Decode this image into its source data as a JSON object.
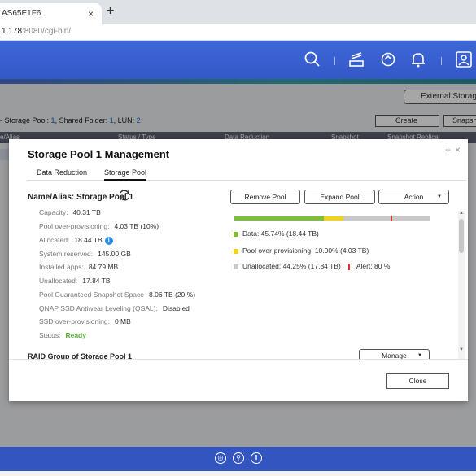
{
  "browser": {
    "tab_title": "AS65E1F6",
    "tab_close": "×",
    "new_tab": "+",
    "address_host": "1.178",
    "address_rest": ":8080/cgi-bin/"
  },
  "header": {
    "icons": [
      "search-icon",
      "tasks-icon",
      "sync-icon",
      "bell-icon",
      "user-icon"
    ],
    "accent_color": "#3f67d8"
  },
  "background": {
    "external_storage_label": "External Storage",
    "summary_prefix": "- Storage Pool: ",
    "summary_pool_count": "1",
    "summary_folder_label": ", Shared Folder: ",
    "summary_folder_count": "1",
    "summary_lun_label": ", LUN: ",
    "summary_lun_count": "2",
    "create_label": "Create",
    "snapshot_label": "Snapsh",
    "columns": [
      "e/Alias",
      "Status / Type",
      "Data Reduction",
      "Snapshot",
      "Snapshot Replica"
    ]
  },
  "modal": {
    "title": "Storage Pool 1 Management",
    "tabs": [
      {
        "label": "Data Reduction",
        "active": false
      },
      {
        "label": "Storage Pool",
        "active": true
      }
    ],
    "name_alias": "Name/Alias: Storage Pool 1",
    "info": [
      {
        "label": "Capacity:",
        "value": "40.31 TB"
      },
      {
        "label": "Pool over-provisioning:",
        "value": "4.03 TB (10%)"
      },
      {
        "label": "Allocated:",
        "value": "18.44 TB"
      },
      {
        "label": "System reserved:",
        "value": "145.00 GB"
      },
      {
        "label": "Installed apps:",
        "value": "84.79 MB"
      },
      {
        "label": "Unallocated:",
        "value": "17.84 TB"
      },
      {
        "label": "Pool Guaranteed Snapshot Space",
        "value": "8.06 TB (20 %)"
      },
      {
        "label": "QNAP SSD Antiwear Leveling (QSAL):",
        "value": "Disabled"
      },
      {
        "label": "SSD over-provisioning:",
        "value": "0 MB"
      },
      {
        "label": "Status:",
        "value": "Ready"
      }
    ],
    "buttons": {
      "remove_pool": "Remove Pool",
      "expand_pool": "Expand Pool",
      "action": "Action",
      "manage": "Manage",
      "close": "Close"
    },
    "usage": {
      "data_pct": 45.74,
      "overprov_pct": 10.0,
      "unallocated_pct": 44.25,
      "alert_pct": 80,
      "colors": {
        "data": "#7dbf3b",
        "overprov": "#f2d21b",
        "unallocated": "#c8c8c8",
        "alert": "#d9372b"
      }
    },
    "legend": {
      "data": "Data: 45.74% (18.44 TB)",
      "overprov": "Pool over-provisioning: 10.00% (4.03 TB)",
      "unallocated": "Unallocated: 44.25% (17.84 TB)",
      "alert": "Alert: 80 %"
    },
    "raid_title": "RAID Group of Storage Pool 1"
  }
}
